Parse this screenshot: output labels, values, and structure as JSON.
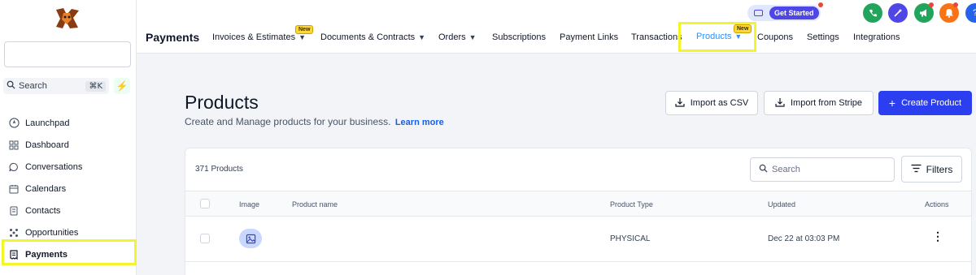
{
  "sidebar": {
    "search_label": "Search",
    "search_shortcut": "⌘K",
    "items": [
      {
        "label": "Launchpad",
        "icon": "rocket-icon"
      },
      {
        "label": "Dashboard",
        "icon": "grid-icon"
      },
      {
        "label": "Conversations",
        "icon": "chat-icon"
      },
      {
        "label": "Calendars",
        "icon": "calendar-icon"
      },
      {
        "label": "Contacts",
        "icon": "contacts-icon"
      },
      {
        "label": "Opportunities",
        "icon": "opportunities-icon"
      },
      {
        "label": "Payments",
        "icon": "receipt-icon",
        "active": true
      }
    ]
  },
  "header": {
    "title": "Payments",
    "tabs": [
      {
        "label": "Invoices & Estimates",
        "badge": "New",
        "dropdown": true
      },
      {
        "label": "Documents & Contracts",
        "dropdown": true
      },
      {
        "label": "Orders",
        "dropdown": true
      },
      {
        "label": "Subscriptions"
      },
      {
        "label": "Payment Links"
      },
      {
        "label": "Transactions"
      },
      {
        "label": "Products",
        "badge": "New",
        "dropdown": true,
        "active": true
      },
      {
        "label": "Coupons"
      },
      {
        "label": "Settings"
      },
      {
        "label": "Integrations"
      }
    ],
    "get_started": "Get Started",
    "colors": {
      "phone": "#22a45d",
      "magic": "#4f46e5",
      "megaphone": "#22a45d",
      "bell": "#f97316",
      "help": "#2563eb"
    }
  },
  "main": {
    "title": "Products",
    "subtitle": "Create and Manage products for your business.",
    "learn_more": "Learn more",
    "import_csv": "Import as CSV",
    "import_stripe": "Import from Stripe",
    "create_product": "Create Product",
    "accent": "#2b3ef0"
  },
  "table": {
    "count": "371 Products",
    "search_placeholder": "Search",
    "filters": "Filters",
    "headers": {
      "image": "Image",
      "name": "Product name",
      "type": "Product Type",
      "updated": "Updated",
      "actions": "Actions"
    },
    "rows": [
      {
        "name": "",
        "type": "PHYSICAL",
        "updated": "Dec 22 at 03:03 PM"
      }
    ]
  }
}
